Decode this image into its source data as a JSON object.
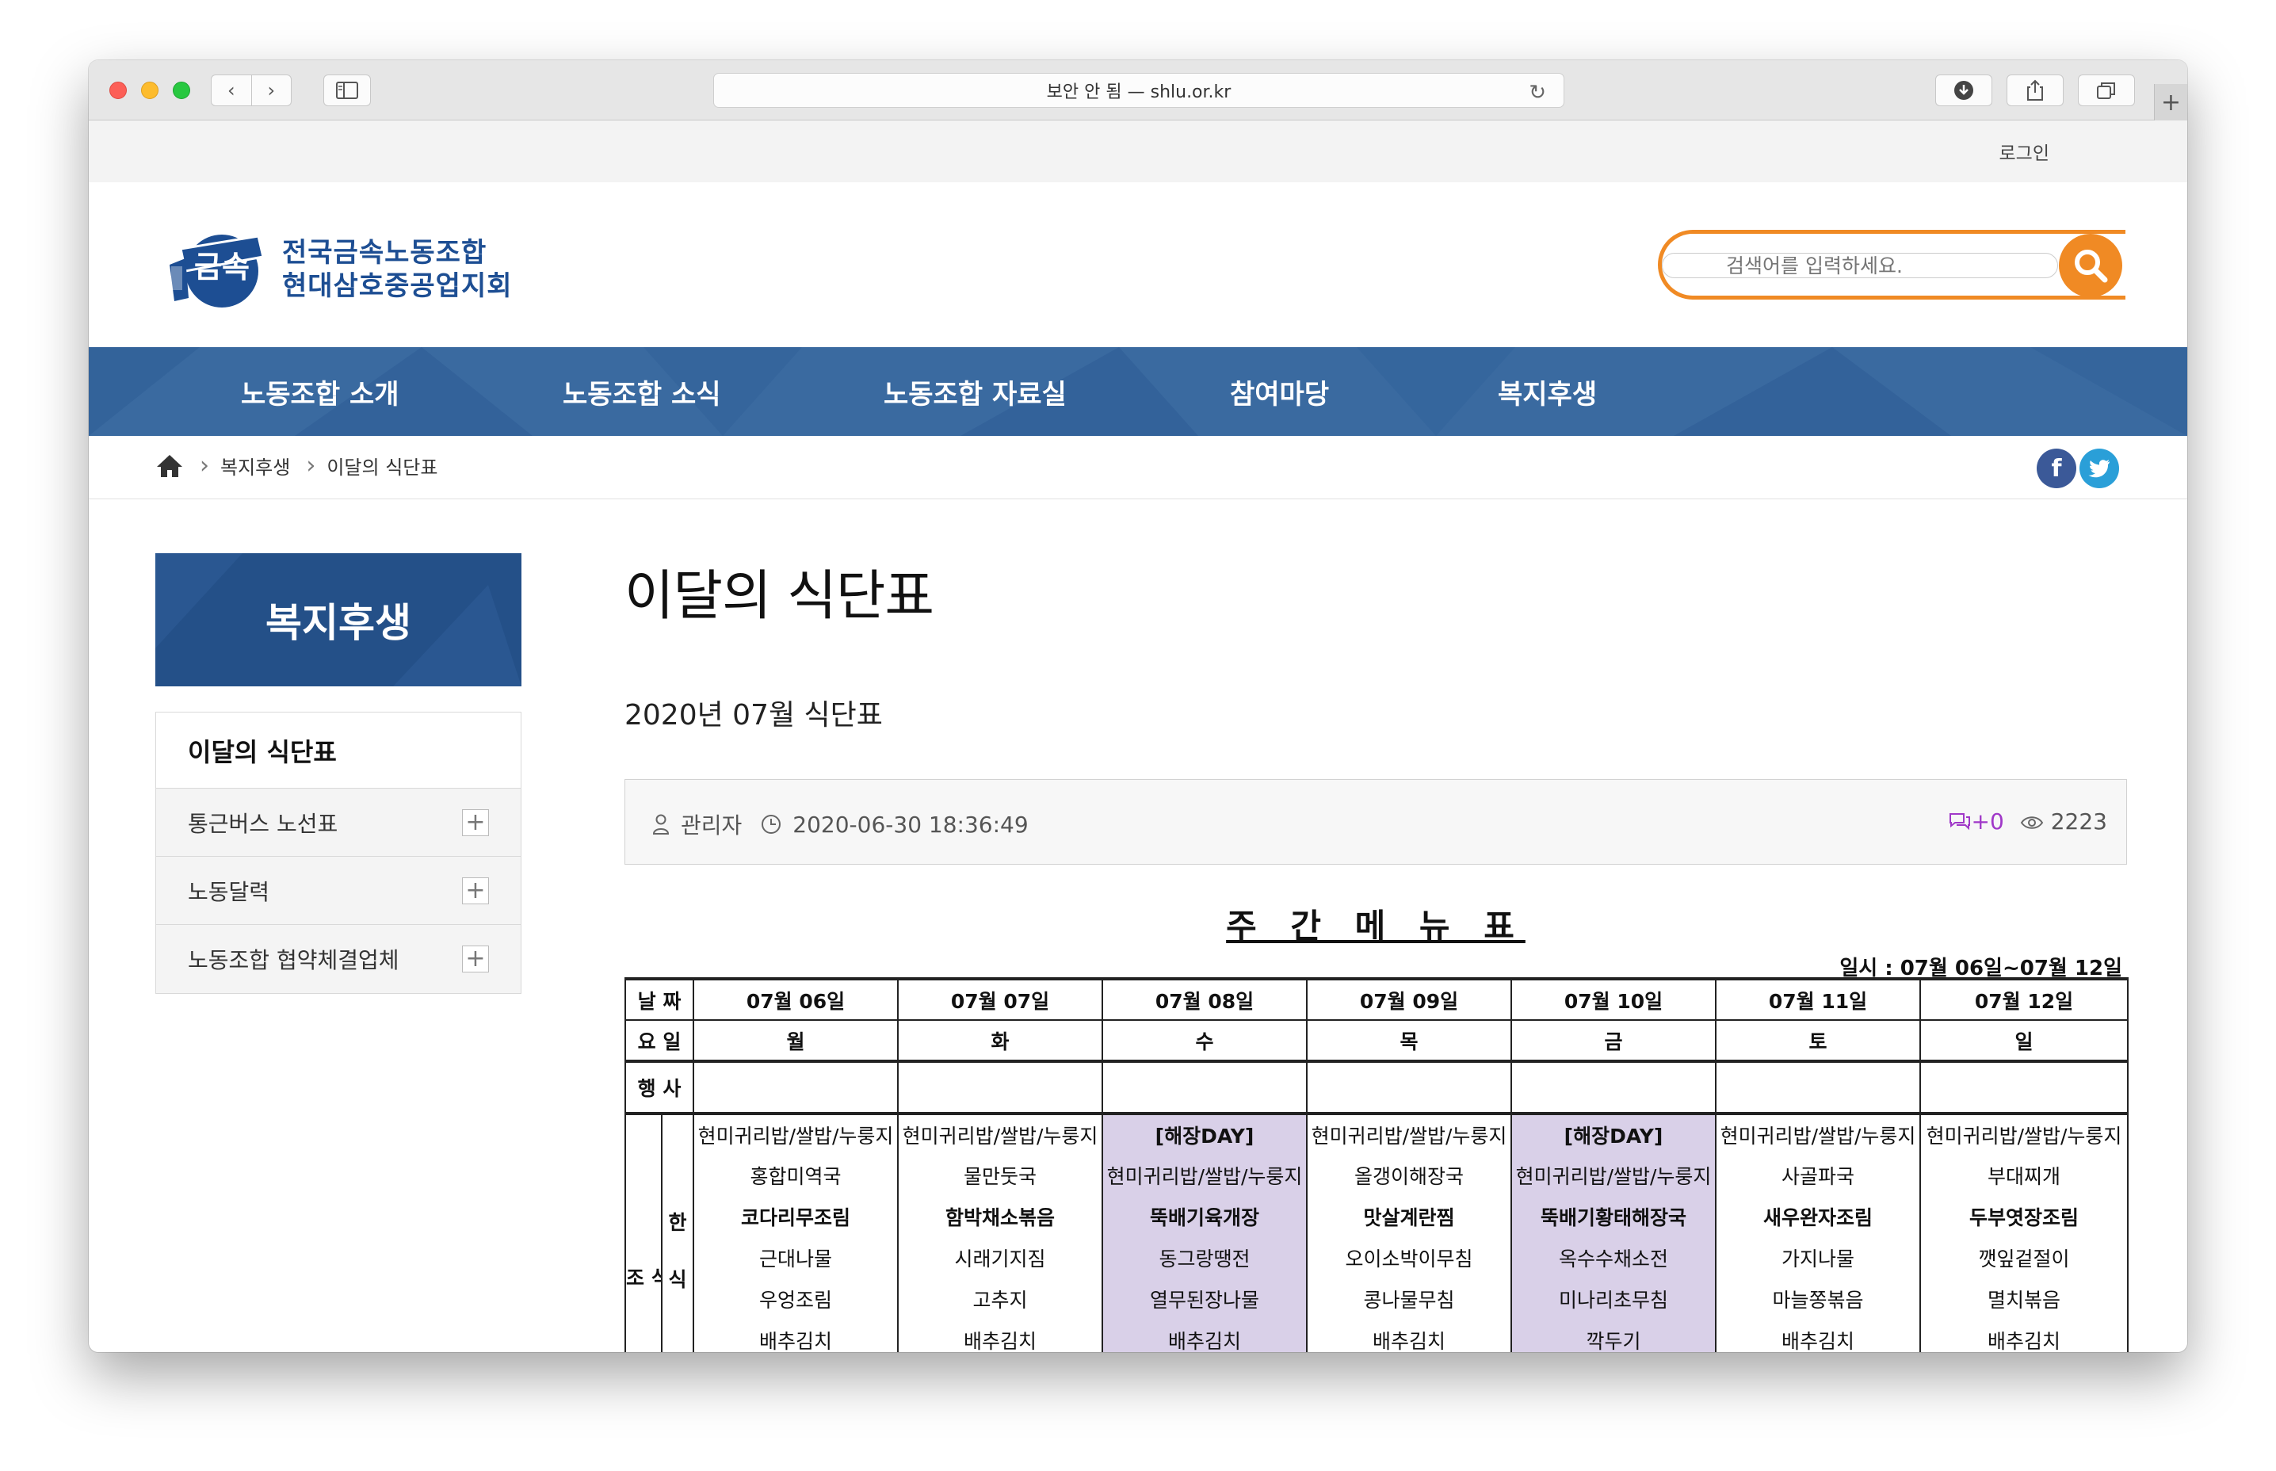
{
  "browser": {
    "address": "보안 안 됨 — shlu.or.kr"
  },
  "topbar": {
    "login": "로그인"
  },
  "logo": {
    "line1": "전국금속노동조합",
    "line2": "현대삼호중공업지회",
    "mark_text": "금속"
  },
  "search": {
    "placeholder": "검색어를 입력하세요."
  },
  "nav": {
    "items": [
      "노동조합 소개",
      "노동조합 소식",
      "노동조합 자료실",
      "참여마당",
      "복지후생"
    ]
  },
  "breadcrumb": {
    "level1": "복지후생",
    "level2": "이달의 식단표"
  },
  "social": {
    "facebook": "f",
    "twitter": "t"
  },
  "sidebar": {
    "title": "복지후생",
    "active": "이달의 식단표",
    "items": [
      "통근버스 노선표",
      "노동달력",
      "노동조합 협약체결업체"
    ]
  },
  "content": {
    "page_title": "이달의 식단표",
    "post_title": "2020년 07월 식단표",
    "author": "관리자",
    "datetime": "2020-06-30 18:36:49",
    "comments": "+0",
    "views": "2223"
  },
  "menu_table": {
    "heading": "주 간 메 뉴 표",
    "period": "일시 : 07월 06일~07월 12일",
    "row_labels": {
      "date": "날 짜",
      "day": "요 일",
      "event": "행 사",
      "breakfast": "조 식",
      "korean": "한 식"
    },
    "dates": [
      "07월 06일",
      "07월 07일",
      "07월 08일",
      "07월 09일",
      "07월 10일",
      "07월 11일",
      "07월 12일"
    ],
    "days": [
      "월",
      "화",
      "수",
      "목",
      "금",
      "토",
      "일"
    ],
    "rows": [
      [
        "현미귀리밥/쌀밥/누룽지",
        "현미귀리밥/쌀밥/누룽지",
        "[해장DAY]",
        "현미귀리밥/쌀밥/누룽지",
        "[해장DAY]",
        "현미귀리밥/쌀밥/누룽지",
        "현미귀리밥/쌀밥/누룽지"
      ],
      [
        "홍합미역국",
        "물만둣국",
        "현미귀리밥/쌀밥/누룽지",
        "올갱이해장국",
        "현미귀리밥/쌀밥/누룽지",
        "사골파국",
        "부대찌개"
      ],
      [
        "코다리무조림",
        "함박채소볶음",
        "뚝배기육개장",
        "맛살계란찜",
        "뚝배기황태해장국",
        "새우완자조림",
        "두부엿장조림"
      ],
      [
        "근대나물",
        "시래기지짐",
        "동그랑땡전",
        "오이소박이무침",
        "옥수수채소전",
        "가지나물",
        "깻잎겉절이"
      ],
      [
        "우엉조림",
        "고추지",
        "열무된장나물",
        "콩나물무침",
        "미나리초무침",
        "마늘쫑볶음",
        "멸치볶음"
      ],
      [
        "배추김치",
        "배추김치",
        "배추김치",
        "배추김치",
        "깍두기",
        "배추김치",
        "배추김치"
      ]
    ]
  }
}
